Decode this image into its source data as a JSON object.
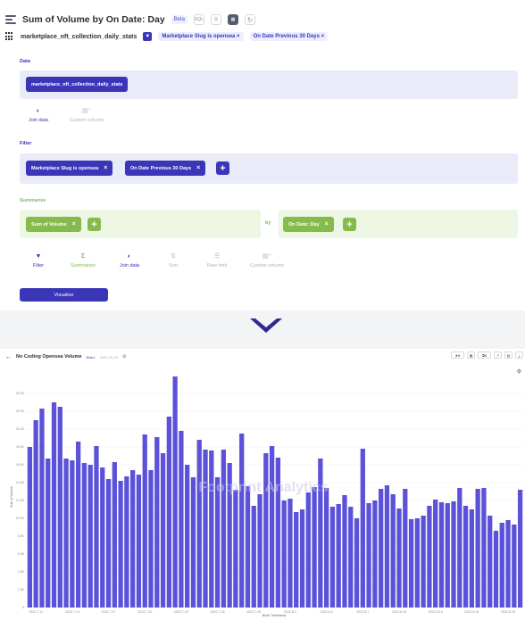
{
  "query": {
    "title": "Sum of Volume by On Date: Day",
    "beta": "Beta",
    "sql_label": "SQL",
    "table": "marketplace_nft_collection_daily_stats",
    "filters": [
      "Marketplace Slug is opensea",
      "On Date Previous 30 Days"
    ]
  },
  "editor": {
    "data_label": "Data",
    "data_table": "marketplace_nft_collection_daily_stats",
    "join_label": "Join data",
    "custom_label": "Custom column",
    "filter_label": "Filter",
    "filter1": "Marketplace Slug is opensea",
    "filter2": "On Date Previous 30 Days",
    "summarize_label": "Summarize",
    "metric": "Sum of Volume",
    "by_label": "by",
    "group": "On Date: Day",
    "tools": [
      "Filter",
      "Summarize",
      "Join data",
      "Sort",
      "Row limit",
      "Custom column"
    ],
    "visualize": "Visualize"
  },
  "colors": {
    "primary": "#3b35b8",
    "summarize": "#84bb4c",
    "bar": "#5b52d9"
  },
  "dashboard": {
    "title": "No Coding Opensea Volume",
    "tag": "Blake",
    "date": "2022-10-13",
    "likes": "0",
    "copies": "0",
    "watermark": "Footprint Analytics"
  },
  "chart_data": {
    "type": "bar",
    "xlabel": "Block Timestamp",
    "ylabel": "Sum of Volume",
    "ylim": [
      0,
      26000
    ],
    "yticks": [
      0,
      2000,
      4000,
      6000,
      8000,
      10000,
      12000,
      14000,
      16000,
      18000,
      20000,
      22000,
      24000
    ],
    "ytick_labels": [
      "0",
      "2.0K",
      "4.0K",
      "6.0K",
      "8.0K",
      "10.0K",
      "12.0K",
      "14.0K",
      "16.0K",
      "18.0K",
      "20.0K",
      "22.0K",
      "24.0K"
    ],
    "xtick_labels": [
      "2022-7-11",
      "2022-7-14",
      "2022-7-17",
      "2022-7-20",
      "2022-7-23",
      "2022-7-26",
      "2022-7-29",
      "2022-8-1",
      "2022-8-4",
      "2022-8-7",
      "2022-8-10",
      "2022-8-13",
      "2022-8-16",
      "2022-8-19"
    ],
    "values": [
      18000,
      21000,
      22300,
      16700,
      23000,
      22500,
      16700,
      16500,
      18600,
      16200,
      16000,
      18100,
      15700,
      14400,
      16300,
      14200,
      14700,
      15400,
      14900,
      19400,
      15400,
      19100,
      17300,
      21400,
      25900,
      19800,
      16000,
      14600,
      18800,
      17700,
      17600,
      14600,
      17700,
      16200,
      13200,
      19500,
      13600,
      11400,
      12700,
      17300,
      18100,
      16800,
      12000,
      12200,
      10700,
      11000,
      12900,
      13500,
      16700,
      13400,
      11300,
      11600,
      12600,
      11300,
      10000,
      17800,
      11700,
      12000,
      13300,
      13700,
      12700,
      11100,
      13300,
      9900,
      10000,
      10300,
      11400,
      12100,
      11800,
      11700,
      11900,
      13400,
      11400,
      11000,
      13300,
      13400,
      10300,
      8600,
      9500,
      9800,
      9300,
      13200
    ]
  }
}
